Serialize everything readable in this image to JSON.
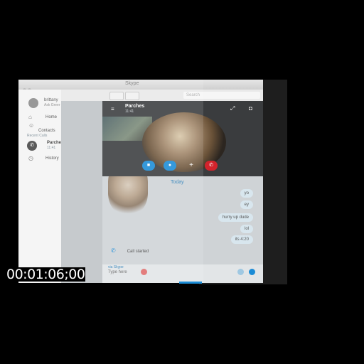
{
  "window": {
    "title": "Skype"
  },
  "toolbar": {
    "search_placeholder": "Search"
  },
  "profile": {
    "name": "brittany",
    "status": "Ask Greer"
  },
  "sidebar": {
    "items": [
      {
        "label": "Home",
        "icon": "home-icon"
      },
      {
        "label": "Contacts",
        "icon": "contacts-icon"
      }
    ],
    "section_label": "Recent Calls",
    "recent": {
      "name": "Parches",
      "time": "11:41",
      "badge": "–"
    },
    "history_label": "History"
  },
  "call": {
    "name": "Parches",
    "time": "11:41"
  },
  "conversation": {
    "day_label": "Today",
    "messages": [
      "yo",
      "ey",
      "hurry up dude",
      "lol",
      "its 4:20"
    ],
    "call_started": "Call started"
  },
  "compose": {
    "network_label": "via Skype",
    "placeholder": "Type here"
  },
  "overlay": {
    "timecode": "00:01:06;00"
  },
  "colors": {
    "accent": "#1a8bd6",
    "end_call": "#d3232c"
  }
}
